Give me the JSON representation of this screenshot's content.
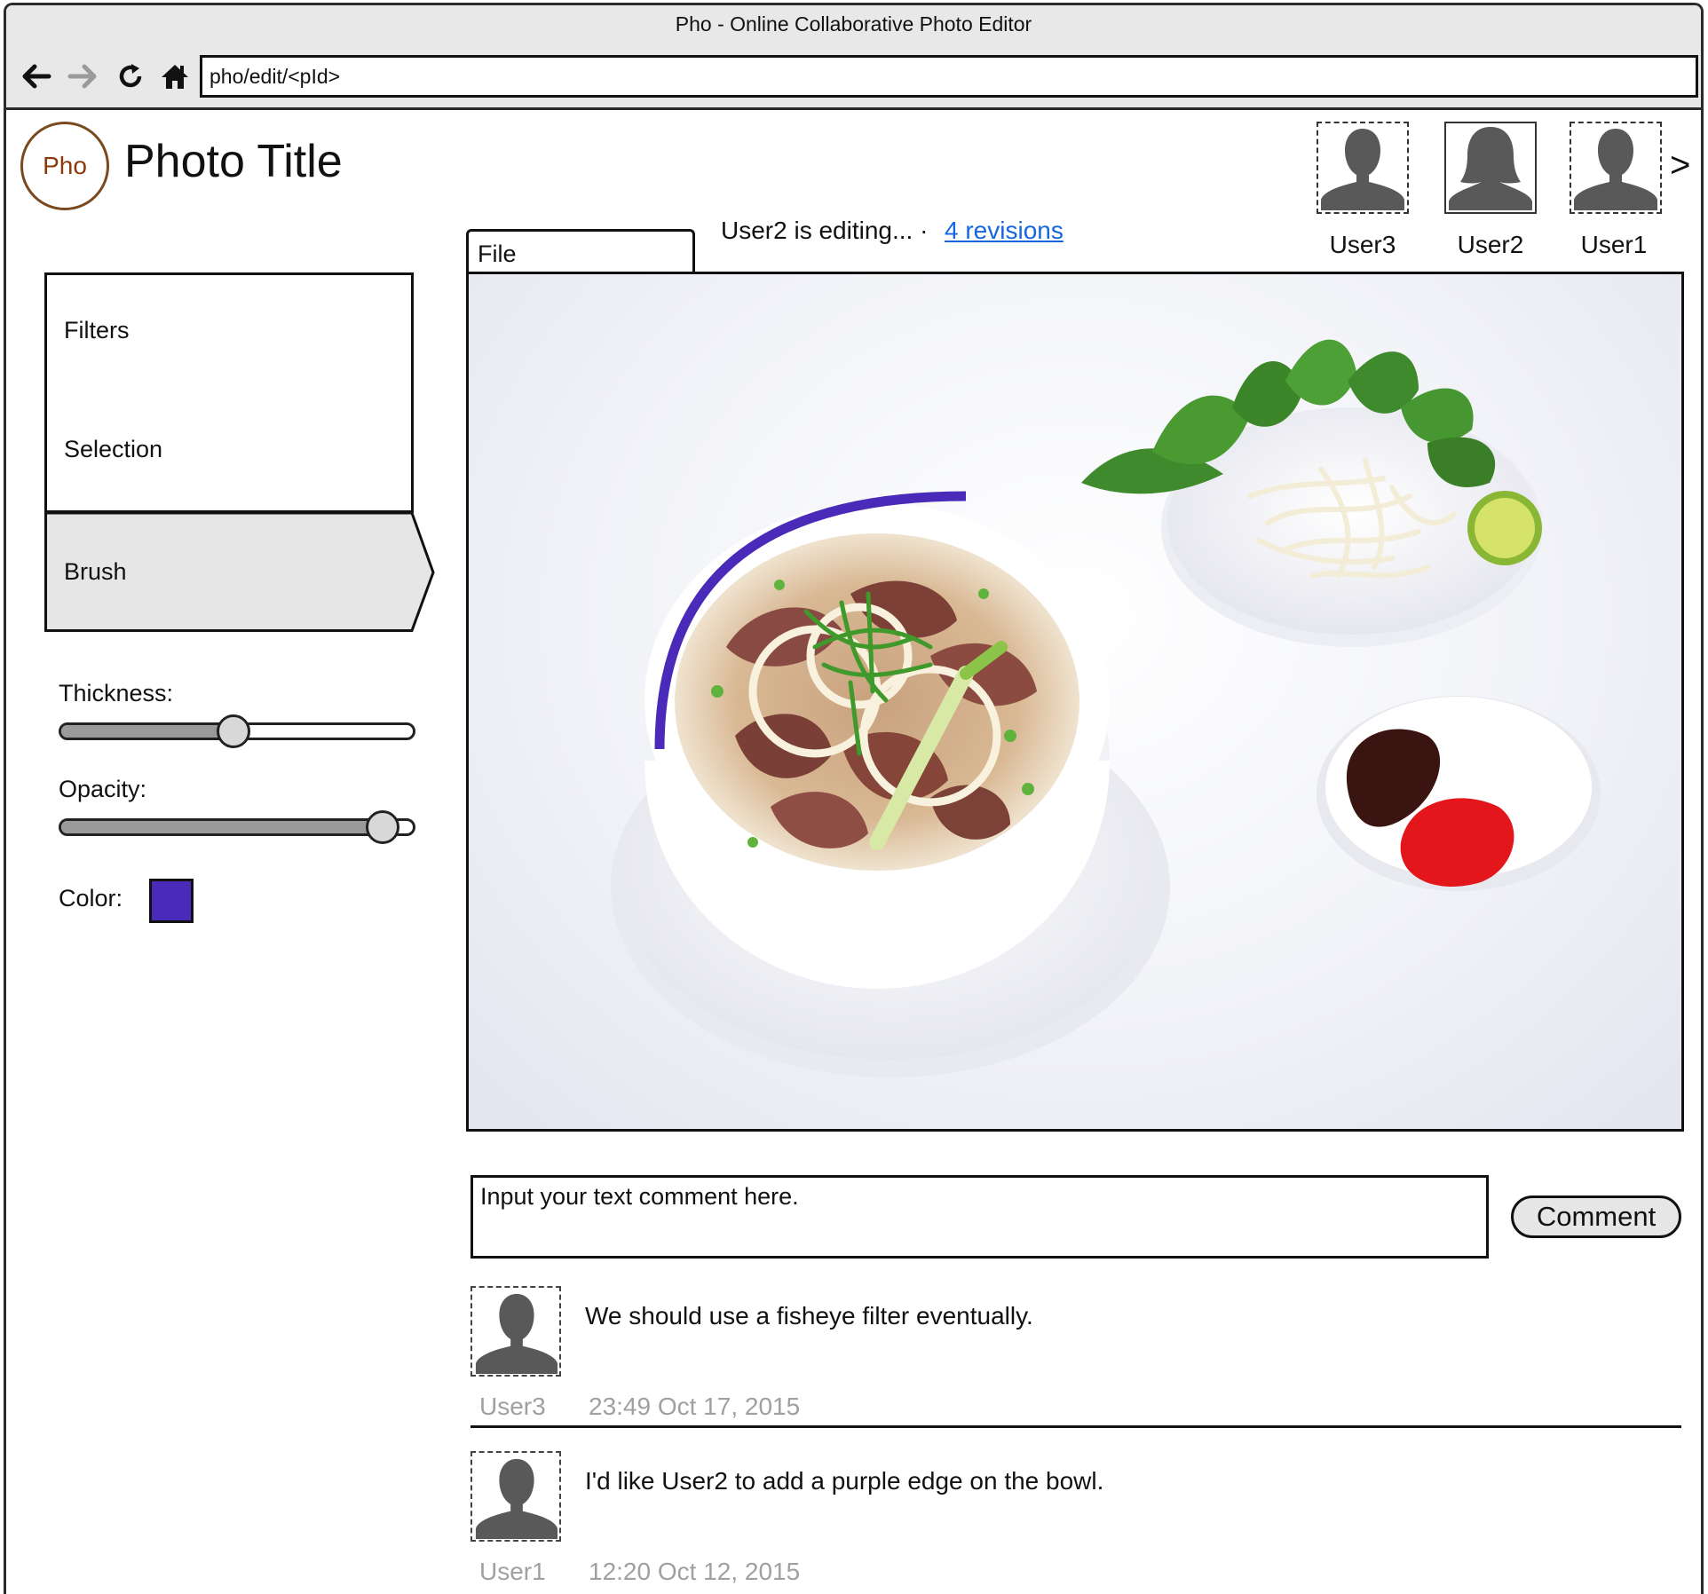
{
  "window": {
    "title": "Pho - Online Collaborative Photo Editor"
  },
  "nav": {
    "back_icon": "arrow-left-icon",
    "forward_icon": "arrow-right-icon",
    "reload_icon": "reload-icon",
    "home_icon": "home-icon",
    "url": "pho/edit/<pId>"
  },
  "header": {
    "logo_text": "Pho",
    "photo_title": "Photo Title",
    "collaborators": [
      {
        "name": "User3",
        "avatar": "male-avatar-icon"
      },
      {
        "name": "User2",
        "avatar": "female-avatar-icon"
      },
      {
        "name": "User1",
        "avatar": "male-avatar-icon"
      }
    ],
    "more_label": ">"
  },
  "editor": {
    "file_tab": "File",
    "status": "User2 is editing...  ·",
    "revisions_link": "4 revisions",
    "brush_stroke_color": "#4a2ab8"
  },
  "tools": {
    "items": [
      {
        "label": "Filters",
        "selected": false
      },
      {
        "label": "Selection",
        "selected": false
      },
      {
        "label": "Brush",
        "selected": true
      }
    ],
    "thickness_label": "Thickness:",
    "thickness_value": 0.49,
    "opacity_label": "Opacity:",
    "opacity_value": 0.95,
    "color_label": "Color:",
    "color_value": "#4a2ab8"
  },
  "comment_box": {
    "placeholder": "Input your text comment here.",
    "button_label": "Comment"
  },
  "comments": [
    {
      "author": "User3",
      "time": "23:49 Oct 17, 2015",
      "text": "We should use a fisheye filter eventually."
    },
    {
      "author": "User1",
      "time": "12:20 Oct 12, 2015",
      "text": "I'd like User2 to add a purple edge on the bowl."
    }
  ]
}
